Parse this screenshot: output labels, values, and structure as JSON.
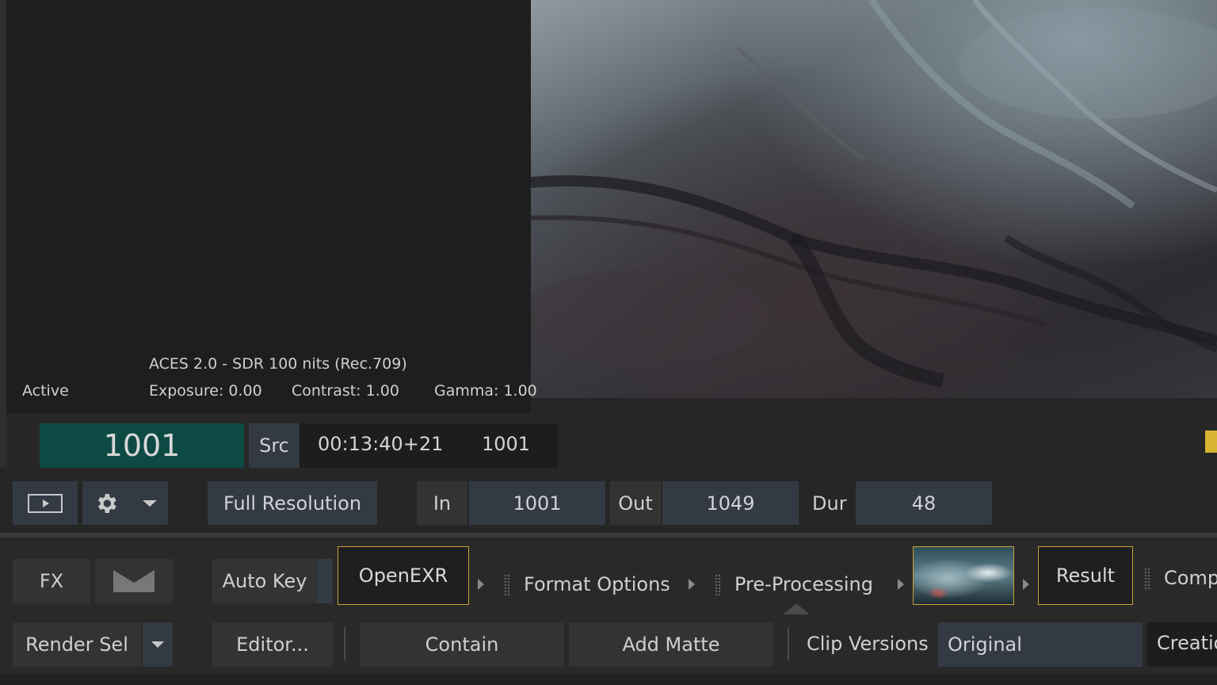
{
  "viewer": {
    "colorspace": "ACES 2.0 - SDR 100 nits (Rec.709)",
    "status": "Active",
    "exposure": "Exposure: 0.00",
    "contrast": "Contrast: 1.00",
    "gamma": "Gamma: 1.00"
  },
  "timecode": {
    "frame": "1001",
    "source_label": "Src",
    "source_timecode": "00:13:40+21",
    "source_frame": "1001"
  },
  "controls": {
    "resolution": "Full Resolution",
    "in_label": "In",
    "in_value": "1001",
    "out_label": "Out",
    "out_value": "1049",
    "dur_label": "Dur",
    "dur_value": "48"
  },
  "pipeline": {
    "fx_label": "FX",
    "auto_key_label": "Auto Key",
    "openexr_label": "OpenEXR",
    "format_options_label": "Format Options",
    "pre_processing_label": "Pre-Processing",
    "result_label": "Result",
    "comp_label": "Comp"
  },
  "bottom": {
    "render_sel_label": "Render Sel",
    "editor_label": "Editor...",
    "contain_label": "Contain",
    "add_matte_label": "Add Matte",
    "clip_versions_label": "Clip Versions",
    "clip_version_value": "Original",
    "creation_label": "Creatio"
  },
  "colors": {
    "accent_border": "#c9a233",
    "frame_bg": "#0d4a44",
    "panel_bg": "#333a44",
    "indicator": "#d6b431"
  }
}
